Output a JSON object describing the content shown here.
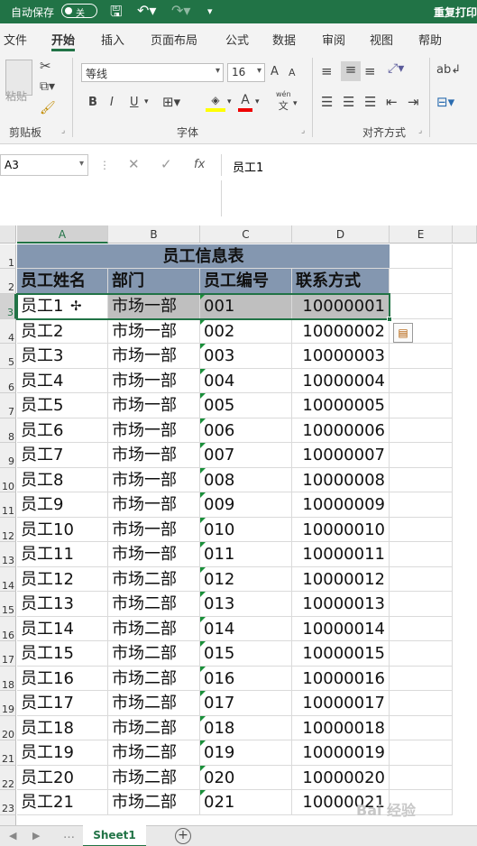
{
  "titlebar": {
    "autosave_label": "自动保存",
    "autosave_state": "关",
    "right_text": "重复打印"
  },
  "tabs": [
    "文件",
    "开始",
    "插入",
    "页面布局",
    "公式",
    "数据",
    "审阅",
    "视图",
    "帮助"
  ],
  "ribbon": {
    "paste_label": "粘贴",
    "clipboard_label": "剪贴板",
    "font_name": "等线",
    "font_size": "16",
    "font_group_label": "字体",
    "align_group_label": "对齐方式",
    "bold": "B",
    "italic": "I",
    "underline": "U",
    "grow_font": "A",
    "shrink_font": "A",
    "wen": "wén",
    "wen_sub": "文"
  },
  "formula_bar": {
    "name_box": "A3",
    "fx": "fx",
    "formula": "员工1"
  },
  "columns": [
    "A",
    "B",
    "C",
    "D",
    "E"
  ],
  "selected_column": "A",
  "selected_row": 3,
  "sheet": {
    "title": "员工信息表",
    "headers": [
      "员工姓名",
      "部门",
      "员工编号",
      "联系方式"
    ],
    "rows": [
      [
        "员工1",
        "市场一部",
        "001",
        "10000001"
      ],
      [
        "员工2",
        "市场一部",
        "002",
        "10000002"
      ],
      [
        "员工3",
        "市场一部",
        "003",
        "10000003"
      ],
      [
        "员工4",
        "市场一部",
        "004",
        "10000004"
      ],
      [
        "员工5",
        "市场一部",
        "005",
        "10000005"
      ],
      [
        "员工6",
        "市场一部",
        "006",
        "10000006"
      ],
      [
        "员工7",
        "市场一部",
        "007",
        "10000007"
      ],
      [
        "员工8",
        "市场一部",
        "008",
        "10000008"
      ],
      [
        "员工9",
        "市场一部",
        "009",
        "10000009"
      ],
      [
        "员工10",
        "市场一部",
        "010",
        "10000010"
      ],
      [
        "员工11",
        "市场一部",
        "011",
        "10000011"
      ],
      [
        "员工12",
        "市场二部",
        "012",
        "10000012"
      ],
      [
        "员工13",
        "市场二部",
        "013",
        "10000013"
      ],
      [
        "员工14",
        "市场二部",
        "014",
        "10000014"
      ],
      [
        "员工15",
        "市场二部",
        "015",
        "10000015"
      ],
      [
        "员工16",
        "市场二部",
        "016",
        "10000016"
      ],
      [
        "员工17",
        "市场二部",
        "017",
        "10000017"
      ],
      [
        "员工18",
        "市场二部",
        "018",
        "10000018"
      ],
      [
        "员工19",
        "市场二部",
        "019",
        "10000019"
      ],
      [
        "员工20",
        "市场二部",
        "020",
        "10000020"
      ],
      [
        "员工21",
        "市场二部",
        "021",
        "10000021"
      ]
    ]
  },
  "sheet_tabs": [
    "Sheet1"
  ],
  "watermark": "Bai 经验",
  "colors": {
    "excel_green": "#217346",
    "header_fill": "#8497b0",
    "highlight_fill": "#bfbfbf"
  }
}
